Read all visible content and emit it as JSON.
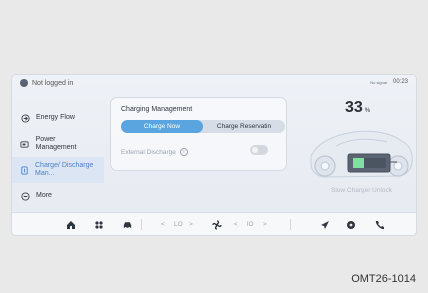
{
  "topbar": {
    "user": "Not logged in",
    "signal": "No signal",
    "time": "00:23"
  },
  "sidebar": {
    "items": [
      {
        "label": "Energy Flow",
        "icon": "energy-flow-icon",
        "active": false
      },
      {
        "label": "Power Management",
        "icon": "power-management-icon",
        "active": false
      },
      {
        "label": "Charge/ Discharge Man...",
        "icon": "charge-discharge-icon",
        "active": true
      },
      {
        "label": "More",
        "icon": "more-icon",
        "active": false
      }
    ]
  },
  "charging": {
    "title": "Charging Management",
    "buttons": [
      "Charge Now",
      "Charge Reservatin"
    ],
    "external_discharge": "External Discharge"
  },
  "battery": {
    "percent": "33",
    "unit": "%",
    "charger_label": "Slow Charger Unlock"
  },
  "dock": {
    "left_temp": "LO",
    "right_temp": "lO"
  },
  "caption": "OMT26-1014",
  "colors": {
    "accent": "#5aa5df",
    "active_bg": "#dbe5f3",
    "battery_green": "#7fe0a0"
  }
}
